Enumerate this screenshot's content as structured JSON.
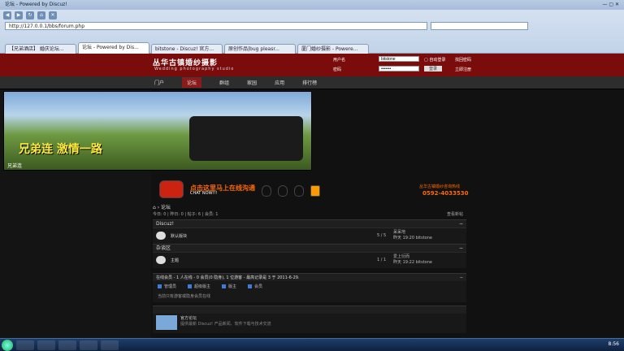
{
  "window": {
    "title": "论坛 - Powered by Discuz!",
    "clock": "8:56"
  },
  "addressbar": {
    "url": "http://127.0.0.1/bbs/forum.php"
  },
  "tabs": [
    {
      "label": "【兄弟酒店】 婚庆论坛..."
    },
    {
      "label": "论坛 - Powered by Dis...",
      "active": true
    },
    {
      "label": "bitstone - Discuz! 官方..."
    },
    {
      "label": "原创作品|bug pleasr..."
    },
    {
      "label": "厦门婚纱摄影 - Powere..."
    }
  ],
  "header": {
    "logo_cn": "丛华古镇婚纱摄影",
    "logo_en": "Wedding photography studio",
    "login": {
      "username_label": "用户名",
      "username_value": "bitstone",
      "password_label": "密码",
      "password_value": "•••••••",
      "remember_label": "自动登录",
      "forgot_label": "找回密码",
      "login_button": "登录",
      "register_button": "立即注册"
    }
  },
  "nav": [
    {
      "label": "门户"
    },
    {
      "label": "论坛",
      "active": true
    },
    {
      "label": "群组"
    },
    {
      "label": "家园"
    },
    {
      "label": "应用"
    },
    {
      "label": "排行榜"
    }
  ],
  "banner": {
    "title": "兄弟连 激情一路",
    "tag": "兄弟连"
  },
  "chat": {
    "title": "点击这里马上在线沟通",
    "subtitle": "CHAT NOW!!!"
  },
  "hotline": {
    "label": "丛华古镇婚纱咨询热线",
    "number": "0592-4033530"
  },
  "forum": {
    "crumb": "论坛",
    "stats": "今日: 0 | 昨日: 0 | 帖子: 6 | 会员: 1",
    "view_new": "查看新帖",
    "sections": [
      {
        "title": "Discuz!",
        "forum": {
          "name": "默认版块",
          "count": "5 / 5",
          "last_title": "呆呆地",
          "last_time": "昨天 19:20 bitstone"
        }
      },
      {
        "title": "杂谈区",
        "forum": {
          "name": "主题",
          "count": "1 / 1",
          "last_title": "爱上衍而",
          "last_time": "昨天 19:22 bitstone"
        }
      }
    ],
    "online": {
      "header": "在线会员 - 1 人在线 - 0 会员(0 隐身), 1 位游客 - 最高记录是 3 于 2011-6-29.",
      "legend": [
        "管理员",
        "超级版主",
        "版主",
        "会员"
      ],
      "note": "当前只有游客或隐身会员在线"
    },
    "links": {
      "title": "官方论坛",
      "desc": "提供最新 Discuz! 产品新闻、软件下载与技术交流"
    }
  }
}
